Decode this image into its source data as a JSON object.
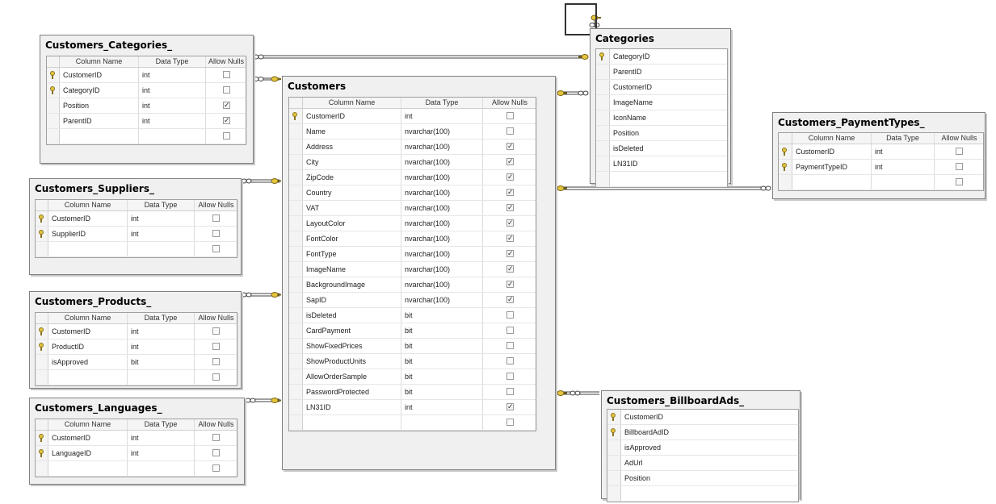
{
  "headers": {
    "column_name": "Column Name",
    "data_type": "Data Type",
    "allow_nulls": "Allow Nulls"
  },
  "colors": {
    "line": "#404040",
    "key": "#e3c43a",
    "panel": "#f0f0f0"
  },
  "tables": [
    {
      "id": "customers_categories",
      "title": "Customers_Categories_",
      "show_types": true,
      "columns": [
        {
          "name": "CustomerID",
          "type": "int",
          "pk": true,
          "nulls": false
        },
        {
          "name": "CategoryID",
          "type": "int",
          "pk": true,
          "nulls": false
        },
        {
          "name": "Position",
          "type": "int",
          "pk": false,
          "nulls": true
        },
        {
          "name": "ParentID",
          "type": "int",
          "pk": false,
          "nulls": true
        }
      ]
    },
    {
      "id": "customers",
      "title": "Customers",
      "show_types": true,
      "columns": [
        {
          "name": "CustomerID",
          "type": "int",
          "pk": true,
          "nulls": false
        },
        {
          "name": "Name",
          "type": "nvarchar(100)",
          "pk": false,
          "nulls": false
        },
        {
          "name": "Address",
          "type": "nvarchar(100)",
          "pk": false,
          "nulls": true
        },
        {
          "name": "City",
          "type": "nvarchar(100)",
          "pk": false,
          "nulls": true
        },
        {
          "name": "ZipCode",
          "type": "nvarchar(100)",
          "pk": false,
          "nulls": true
        },
        {
          "name": "Country",
          "type": "nvarchar(100)",
          "pk": false,
          "nulls": true
        },
        {
          "name": "VAT",
          "type": "nvarchar(100)",
          "pk": false,
          "nulls": true
        },
        {
          "name": "LayoutColor",
          "type": "nvarchar(100)",
          "pk": false,
          "nulls": true
        },
        {
          "name": "FontColor",
          "type": "nvarchar(100)",
          "pk": false,
          "nulls": true
        },
        {
          "name": "FontType",
          "type": "nvarchar(100)",
          "pk": false,
          "nulls": true
        },
        {
          "name": "ImageName",
          "type": "nvarchar(100)",
          "pk": false,
          "nulls": true
        },
        {
          "name": "BackgroundImage",
          "type": "nvarchar(100)",
          "pk": false,
          "nulls": true
        },
        {
          "name": "SapID",
          "type": "nvarchar(100)",
          "pk": false,
          "nulls": true
        },
        {
          "name": "isDeleted",
          "type": "bit",
          "pk": false,
          "nulls": false
        },
        {
          "name": "CardPayment",
          "type": "bit",
          "pk": false,
          "nulls": false
        },
        {
          "name": "ShowFixedPrices",
          "type": "bit",
          "pk": false,
          "nulls": false
        },
        {
          "name": "ShowProductUnits",
          "type": "bit",
          "pk": false,
          "nulls": false
        },
        {
          "name": "AllowOrderSample",
          "type": "bit",
          "pk": false,
          "nulls": false
        },
        {
          "name": "PasswordProtected",
          "type": "bit",
          "pk": false,
          "nulls": false
        },
        {
          "name": "LN31ID",
          "type": "int",
          "pk": false,
          "nulls": true
        }
      ]
    },
    {
      "id": "categories",
      "title": "Categories",
      "show_types": false,
      "columns": [
        {
          "name": "CategoryID",
          "pk": true
        },
        {
          "name": "ParentID",
          "pk": false
        },
        {
          "name": "CustomerID",
          "pk": false
        },
        {
          "name": "ImageName",
          "pk": false
        },
        {
          "name": "IconName",
          "pk": false
        },
        {
          "name": "Position",
          "pk": false
        },
        {
          "name": "isDeleted",
          "pk": false
        },
        {
          "name": "LN31ID",
          "pk": false
        }
      ]
    },
    {
      "id": "customers_paymenttypes",
      "title": "Customers_PaymentTypes_",
      "show_types": true,
      "columns": [
        {
          "name": "CustomerID",
          "type": "int",
          "pk": true,
          "nulls": false
        },
        {
          "name": "PaymentTypeID",
          "type": "int",
          "pk": true,
          "nulls": false
        }
      ]
    },
    {
      "id": "customers_suppliers",
      "title": "Customers_Suppliers_",
      "show_types": true,
      "columns": [
        {
          "name": "CustomerID",
          "type": "int",
          "pk": true,
          "nulls": false
        },
        {
          "name": "SupplierID",
          "type": "int",
          "pk": true,
          "nulls": false
        }
      ]
    },
    {
      "id": "customers_products",
      "title": "Customers_Products_",
      "show_types": true,
      "columns": [
        {
          "name": "CustomerID",
          "type": "int",
          "pk": true,
          "nulls": false
        },
        {
          "name": "ProductID",
          "type": "int",
          "pk": true,
          "nulls": false
        },
        {
          "name": "isApproved",
          "type": "bit",
          "pk": false,
          "nulls": false
        }
      ]
    },
    {
      "id": "customers_languages",
      "title": "Customers_Languages_",
      "show_types": true,
      "columns": [
        {
          "name": "CustomerID",
          "type": "int",
          "pk": true,
          "nulls": false
        },
        {
          "name": "LanguageID",
          "type": "int",
          "pk": true,
          "nulls": false
        }
      ]
    },
    {
      "id": "customers_billboardads",
      "title": "Customers_BillboardAds_",
      "show_types": false,
      "columns": [
        {
          "name": "CustomerID",
          "pk": true
        },
        {
          "name": "BillboardAdID",
          "pk": true
        },
        {
          "name": "isApproved",
          "pk": false
        },
        {
          "name": "AdUrl",
          "pk": false
        },
        {
          "name": "Position",
          "pk": false
        }
      ]
    }
  ]
}
